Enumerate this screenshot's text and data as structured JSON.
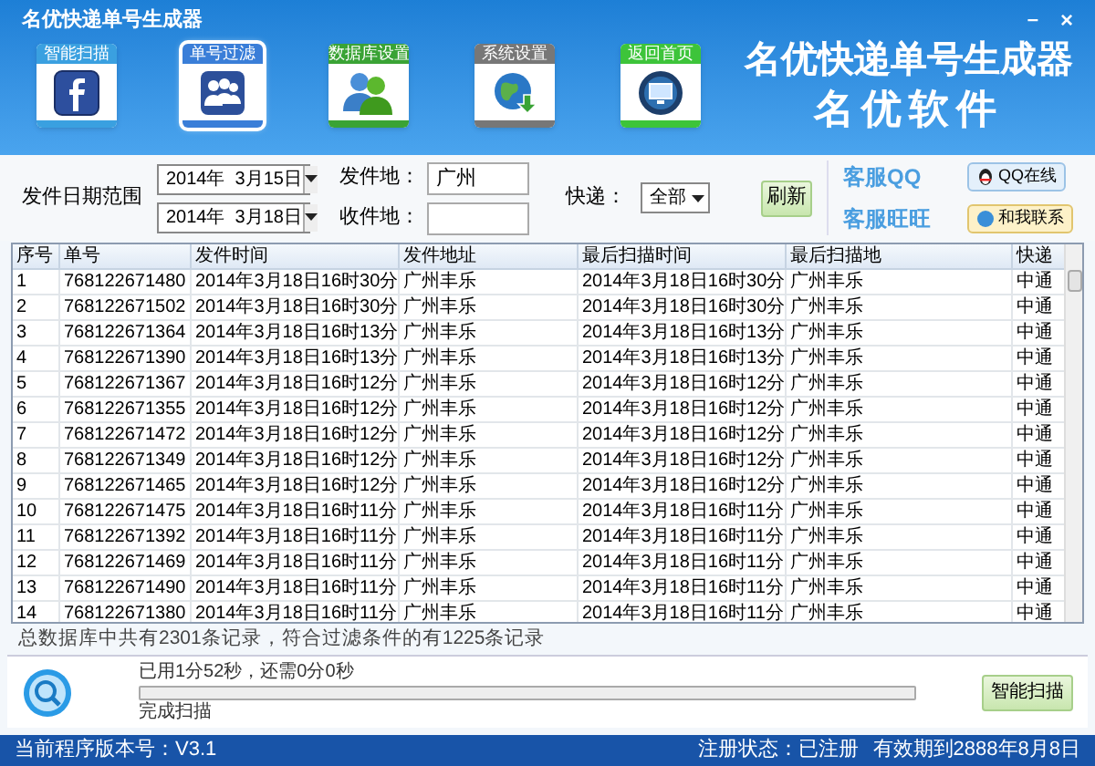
{
  "window": {
    "title": "名优快递单号生成器",
    "minimize": "–",
    "close": "×"
  },
  "nav": [
    {
      "label": "智能扫描",
      "kind": "facebook",
      "selected": false
    },
    {
      "label": "单号过滤",
      "kind": "people",
      "selected": true
    },
    {
      "label": "数据库设置",
      "kind": "users",
      "selected": false
    },
    {
      "label": "系统设置",
      "kind": "globe",
      "selected": false
    },
    {
      "label": "返回首页",
      "kind": "monitor",
      "selected": false
    }
  ],
  "brand": {
    "title": "名优快递单号生成器",
    "subtitle": "名优软件"
  },
  "filter": {
    "date_label": "发件日期范围",
    "date_from": "2014年  3月15日",
    "date_to": "2014年  3月18日",
    "from_label": "发件地：",
    "from_value": "广州",
    "to_label": "收件地：",
    "courier_label": "快递：",
    "courier_value": "全部",
    "refresh": "刷新"
  },
  "support": [
    {
      "label": "客服QQ",
      "button": "QQ在线",
      "kind": "qq"
    },
    {
      "label": "客服旺旺",
      "button": "和我联系",
      "kind": "wangwang"
    }
  ],
  "table": {
    "columns": [
      "序号",
      "单号",
      "发件时间",
      "发件地址",
      "最后扫描时间",
      "最后扫描地",
      "快递"
    ],
    "rows": [
      [
        "1",
        "768122671480",
        "2014年3月18日16时30分",
        "广州丰乐",
        "2014年3月18日16时30分",
        "广州丰乐",
        "中通"
      ],
      [
        "2",
        "768122671502",
        "2014年3月18日16时30分",
        "广州丰乐",
        "2014年3月18日16时30分",
        "广州丰乐",
        "中通"
      ],
      [
        "3",
        "768122671364",
        "2014年3月18日16时13分",
        "广州丰乐",
        "2014年3月18日16时13分",
        "广州丰乐",
        "中通"
      ],
      [
        "4",
        "768122671390",
        "2014年3月18日16时13分",
        "广州丰乐",
        "2014年3月18日16时13分",
        "广州丰乐",
        "中通"
      ],
      [
        "5",
        "768122671367",
        "2014年3月18日16时12分",
        "广州丰乐",
        "2014年3月18日16时12分",
        "广州丰乐",
        "中通"
      ],
      [
        "6",
        "768122671355",
        "2014年3月18日16时12分",
        "广州丰乐",
        "2014年3月18日16时12分",
        "广州丰乐",
        "中通"
      ],
      [
        "7",
        "768122671472",
        "2014年3月18日16时12分",
        "广州丰乐",
        "2014年3月18日16时12分",
        "广州丰乐",
        "中通"
      ],
      [
        "8",
        "768122671349",
        "2014年3月18日16时12分",
        "广州丰乐",
        "2014年3月18日16时12分",
        "广州丰乐",
        "中通"
      ],
      [
        "9",
        "768122671465",
        "2014年3月18日16时12分",
        "广州丰乐",
        "2014年3月18日16时12分",
        "广州丰乐",
        "中通"
      ],
      [
        "10",
        "768122671475",
        "2014年3月18日16时11分",
        "广州丰乐",
        "2014年3月18日16时11分",
        "广州丰乐",
        "中通"
      ],
      [
        "11",
        "768122671392",
        "2014年3月18日16时11分",
        "广州丰乐",
        "2014年3月18日16时11分",
        "广州丰乐",
        "中通"
      ],
      [
        "12",
        "768122671469",
        "2014年3月18日16时11分",
        "广州丰乐",
        "2014年3月18日16时11分",
        "广州丰乐",
        "中通"
      ],
      [
        "13",
        "768122671490",
        "2014年3月18日16时11分",
        "广州丰乐",
        "2014年3月18日16时11分",
        "广州丰乐",
        "中通"
      ],
      [
        "14",
        "768122671380",
        "2014年3月18日16时11分",
        "广州丰乐",
        "2014年3月18日16时11分",
        "广州丰乐",
        "中通"
      ]
    ]
  },
  "summary": "总数据库中共有2301条记录，符合过滤条件的有1225条记录",
  "scan": {
    "elapsed": "已用1分52秒，还需0分0秒",
    "level": 0,
    "status": "完成扫描",
    "button": "智能扫描"
  },
  "status_bar": {
    "version": "当前程序版本号：V3.1",
    "registration": "注册状态：已注册",
    "expiry": "有效期到2888年8月8日"
  }
}
